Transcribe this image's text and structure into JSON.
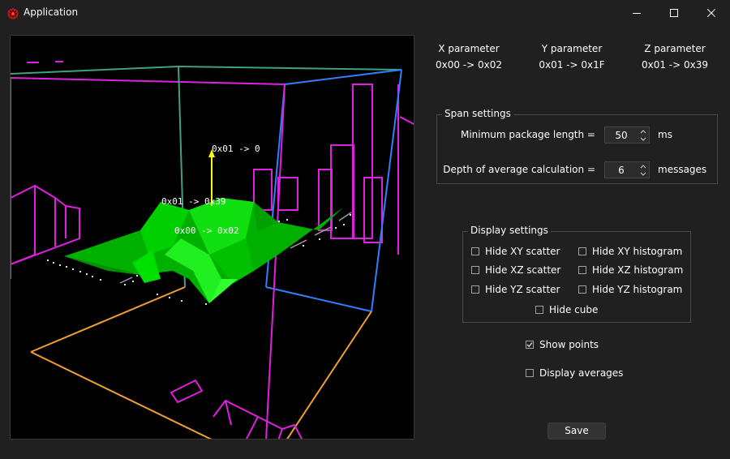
{
  "window": {
    "title": "Application"
  },
  "viewport": {
    "axis_label_vertical": "0x01 -> 0",
    "axis_label_depth": "0x01 -> 0x39",
    "axis_label_horizontal": "0x00 -> 0x02"
  },
  "parameters": [
    {
      "heading": "X parameter",
      "value": "0x00 -> 0x02"
    },
    {
      "heading": "Y parameter",
      "value": "0x01 -> 0x1F"
    },
    {
      "heading": "Z parameter",
      "value": "0x01 -> 0x39"
    }
  ],
  "span_settings": {
    "title": "Span settings",
    "min_package_label": "Minimum package length =",
    "min_package_value": "50",
    "min_package_unit": "ms",
    "depth_label": "Depth of average calculation =",
    "depth_value": "6",
    "depth_unit": "messages"
  },
  "display_settings": {
    "title": "Display settings",
    "options": [
      {
        "label": "Hide XY scatter",
        "checked": false
      },
      {
        "label": "Hide XY histogram",
        "checked": false
      },
      {
        "label": "Hide XZ scatter",
        "checked": false
      },
      {
        "label": "Hide XZ histogram",
        "checked": false
      },
      {
        "label": "Hide YZ scatter",
        "checked": false
      },
      {
        "label": "Hide YZ histogram",
        "checked": false
      },
      {
        "label": "Hide cube",
        "checked": false
      }
    ]
  },
  "show_points": {
    "label": "Show points",
    "checked": true
  },
  "display_averages": {
    "label": "Display averages",
    "checked": false
  },
  "save_label": "Save",
  "colors": {
    "background": "#202020",
    "viewport": "#000000",
    "surface": "#00d000",
    "magenta": "#e020e0",
    "blue": "#2f7fff",
    "orange": "#f0a030",
    "teal": "#40a080",
    "yellow": "#ffff00"
  }
}
